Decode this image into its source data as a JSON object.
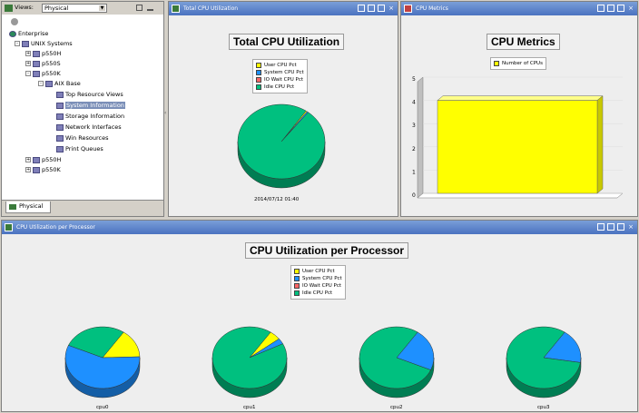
{
  "views_panel": {
    "label": "Views:",
    "selected": "Physical",
    "tree": [
      {
        "label": "Enterprise"
      },
      {
        "label": "UNIX Systems"
      },
      {
        "label": "p550H"
      },
      {
        "label": "p550S"
      },
      {
        "label": "p550K"
      },
      {
        "label": "AIX Base"
      },
      {
        "label": "Top Resource Views"
      },
      {
        "label": "System Information"
      },
      {
        "label": "Storage Information"
      },
      {
        "label": "Network Interfaces"
      },
      {
        "label": "Win Resources"
      },
      {
        "label": "Print Queues"
      },
      {
        "label": "p550H"
      },
      {
        "label": "p550K"
      }
    ],
    "tab": "Physical"
  },
  "total_cpu": {
    "window_title": "Total CPU Utilization",
    "title": "Total CPU Utilization",
    "legend": [
      "User CPU Pct",
      "System CPU Pct",
      "IO Wait CPU Pct",
      "Idle CPU Pct"
    ],
    "caption": "2014/07/12 01:40"
  },
  "cpu_metrics": {
    "window_title": "CPU Metrics",
    "title": "CPU Metrics",
    "legend": [
      "Number of CPUs"
    ],
    "yticks": [
      "5",
      "4",
      "3",
      "2",
      "1",
      "0"
    ]
  },
  "per_processor": {
    "window_title": "CPU Utilization per Processor",
    "title": "CPU Utilization per Processor",
    "legend": [
      "User CPU Pct",
      "System CPU Pct",
      "IO Wait CPU Pct",
      "Idle CPU Pct"
    ],
    "cpus": [
      "cpu0",
      "cpu1",
      "cpu2",
      "cpu3"
    ]
  },
  "colors": {
    "user": "#ffff00",
    "system": "#1e90ff",
    "iowait": "#ff6666",
    "idle": "#00c07f"
  },
  "chart_data": [
    {
      "type": "pie",
      "title": "Total CPU Utilization",
      "categories": [
        "User CPU Pct",
        "System CPU Pct",
        "IO Wait CPU Pct",
        "Idle CPU Pct"
      ],
      "values": [
        0.5,
        0.5,
        0,
        99
      ]
    },
    {
      "type": "bar",
      "title": "CPU Metrics",
      "categories": [
        "Number of CPUs"
      ],
      "values": [
        4
      ],
      "ylim": [
        0,
        5
      ]
    },
    {
      "type": "pie",
      "title": "CPU Utilization per Processor",
      "series": [
        {
          "name": "cpu0",
          "values": [
            15,
            57,
            0,
            28
          ]
        },
        {
          "name": "cpu1",
          "values": [
            5,
            3,
            0,
            92
          ]
        },
        {
          "name": "cpu2",
          "values": [
            0,
            22,
            0,
            78
          ]
        },
        {
          "name": "cpu3",
          "values": [
            0,
            18,
            0,
            82
          ]
        }
      ],
      "categories": [
        "User CPU Pct",
        "System CPU Pct",
        "IO Wait CPU Pct",
        "Idle CPU Pct"
      ]
    }
  ]
}
